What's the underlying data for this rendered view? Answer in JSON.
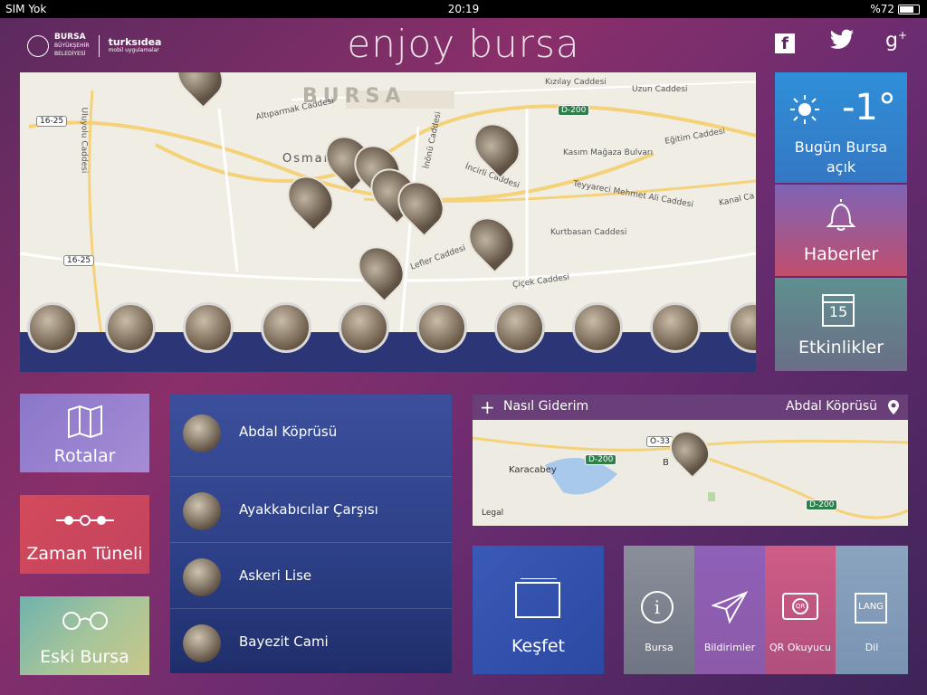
{
  "status_bar": {
    "carrier": "SIM Yok",
    "time": "20:19",
    "battery": "%72"
  },
  "header": {
    "logo_bursa_line1": "BURSA",
    "logo_bursa_line2": "BÜYÜKŞEHİR",
    "logo_bursa_line3": "BELEDİYESİ",
    "logo_turksidea": "turksıdea",
    "logo_turksidea_sub": "mobil uygulamalar",
    "app_title": "enjoy bursa",
    "social": {
      "facebook": "f",
      "twitter": "twitter-icon",
      "googleplus": "g+"
    }
  },
  "map": {
    "city_label": "BURSA",
    "street_labels": [
      "Altıparmak Caddesi",
      "Osman",
      "İnönü Caddesi",
      "Kızılay Caddesi",
      "Uzun Caddesi",
      "Kasım Mağaza Bulvarı",
      "Eğitim Caddesi",
      "İncirli Caddesi",
      "Teyyareci Mehmet Ali Caddesi",
      "Kanal Ca",
      "Kurtbasan Caddesi",
      "Çiçek Caddesi",
      "Lefler Caddesi",
      "Uluyolu Caddesi"
    ],
    "road_shields": [
      "16-25",
      "16-25"
    ],
    "d_shields": [
      "D-200"
    ]
  },
  "tiles_right": {
    "weather_temp": "-1°",
    "weather_text": "Bugün Bursa açık",
    "news_label": "Haberler",
    "events_label": "Etkinlikler",
    "events_day": "15"
  },
  "tiles_left": {
    "rotalar": "Rotalar",
    "zaman": "Zaman Tüneli",
    "eski": "Eski Bursa"
  },
  "places": [
    {
      "name": "Abdal Köprüsü"
    },
    {
      "name": "Ayakkabıcılar Çarşısı"
    },
    {
      "name": "Askeri Lise"
    },
    {
      "name": "Bayezit Cami"
    }
  ],
  "directions": {
    "action": "Nasıl Giderim",
    "destination": "Abdal Köprüsü",
    "labels": {
      "karacabey": "Karacabey",
      "legal": "Legal",
      "o33": "O-33",
      "d200a": "D-200",
      "d200b": "D-200",
      "b": "B"
    }
  },
  "bottom": {
    "kesfet": "Keşfet",
    "buttons": [
      {
        "label": "Bursa",
        "color": "#8a8f9a"
      },
      {
        "label": "Bildirimler",
        "color": "#9a5fb8"
      },
      {
        "label": "QR Okuyucu",
        "color": "#c75c84"
      },
      {
        "label": "Dil",
        "color": "#8aa0b8",
        "icon_text": "LANG"
      }
    ]
  }
}
